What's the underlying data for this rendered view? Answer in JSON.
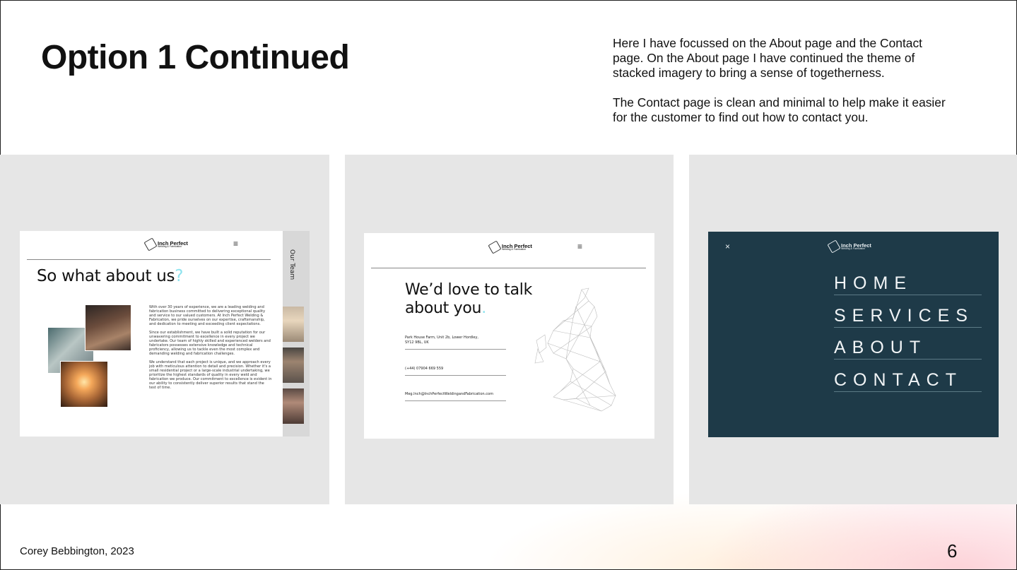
{
  "slide": {
    "title": "Option 1 Continued",
    "description": [
      "Here I have focussed on the About page and the Contact page. On the About page I have continued the theme of stacked imagery to bring a sense of togetherness.",
      "The Contact page is clean and minimal to help make it easier for the customer to find out how to contact you."
    ],
    "author": "Corey Bebbington, 2023",
    "page_number": "6"
  },
  "brand": {
    "name": "Inch Perfect",
    "tagline": "Welding & Fabrication"
  },
  "about_mockup": {
    "heading": "So what about us",
    "heading_accent": "?",
    "side_tab": "Our Team",
    "paragraphs": [
      "With over 30 years of experience, we are a leading welding and fabrication business committed to delivering exceptional quality and service to our valued customers. At Inch Perfect Welding & Fabrication, we pride ourselves on our expertise, craftsmanship, and dedication to meeting and exceeding client expectations.",
      "Since our establishment, we have built a solid reputation for our unwavering commitment to excellence in every project we undertake. Our team of highly skilled and experienced welders and fabricators possesses extensive knowledge and technical proficiency, allowing us to tackle even the most complex and demanding welding and fabrication challenges.",
      "We understand that each project is unique, and we approach every job with meticulous attention to detail and precision. Whether it's a small residential project or a large-scale industrial undertaking, we prioritize the highest standards of quality in every weld and fabrication we produce. Our commitment to excellence is evident in our ability to consistently deliver superior results that stand the test of time."
    ]
  },
  "contact_mockup": {
    "heading_line1": "We’d love to talk",
    "heading_line2": "about you",
    "heading_accent": ".",
    "address_line1": "Park House Farm, Unit 2b, Lower Hordley,",
    "address_line2": "SY12 9BL, UK",
    "phone": "(+44) 07904 669 559",
    "email": "Meg.Inch@InchPerfectWeldingandFabrication.com"
  },
  "menu_mockup": {
    "close_icon": "×",
    "items": [
      "HOME",
      "SERVICES",
      "ABOUT",
      "CONTACT"
    ]
  },
  "colors": {
    "accent_cyan": "#8ee3ee",
    "menu_bg": "#1e3a48",
    "panel_bg": "#e6e6e6"
  }
}
